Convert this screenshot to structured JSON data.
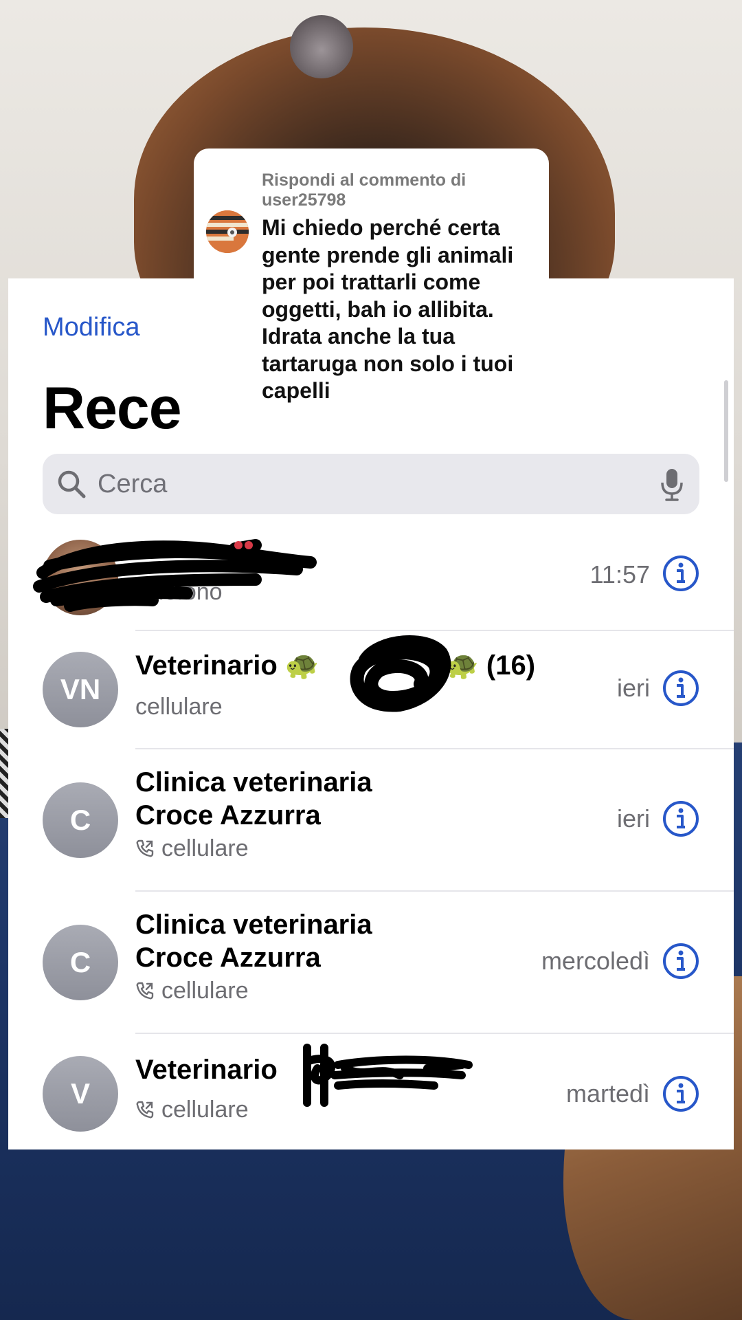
{
  "colors": {
    "accent": "#2757c9",
    "secondary_text": "#6d6d72",
    "search_bg": "#e8e8ed",
    "avatar_gray": "#8e909a"
  },
  "comment": {
    "header": "Rispondi al commento di user25798",
    "text": "Mi chiedo perché certa gente prende gli animali per poi trattarli come oggetti, bah io allibita. Idrata anche la tua tartaruga non solo i tuoi capelli"
  },
  "header": {
    "edit_label": "Modifica",
    "title": "Recenti",
    "title_visible": "Rece"
  },
  "search": {
    "placeholder": "Cerca",
    "icon": "magnifier-icon",
    "mic_icon": "microphone-icon"
  },
  "recents": [
    {
      "name": "",
      "initials": "",
      "subtitle": "elefono",
      "time": "11:57",
      "redacted": true
    },
    {
      "name": "Veterinario",
      "emoji": "🐢",
      "emoji_after": "🐢",
      "count": "(16)",
      "initials": "VN",
      "subtitle": "cellulare",
      "time": "ieri"
    },
    {
      "name_line1": "Clinica veterinaria",
      "name_line2": "Croce Azzurra",
      "initials": "C",
      "subtitle": "cellulare",
      "time": "ieri",
      "outgoing_icon": "outgoing-call-icon"
    },
    {
      "name_line1": "Clinica veterinaria",
      "name_line2": "Croce Azzurra",
      "initials": "C",
      "subtitle": "cellulare",
      "time": "mercoledì",
      "outgoing_icon": "outgoing-call-icon"
    },
    {
      "name": "Veterinario",
      "initials": "V",
      "subtitle": "cellulare",
      "time": "martedì",
      "outgoing_icon": "outgoing-call-icon"
    }
  ]
}
